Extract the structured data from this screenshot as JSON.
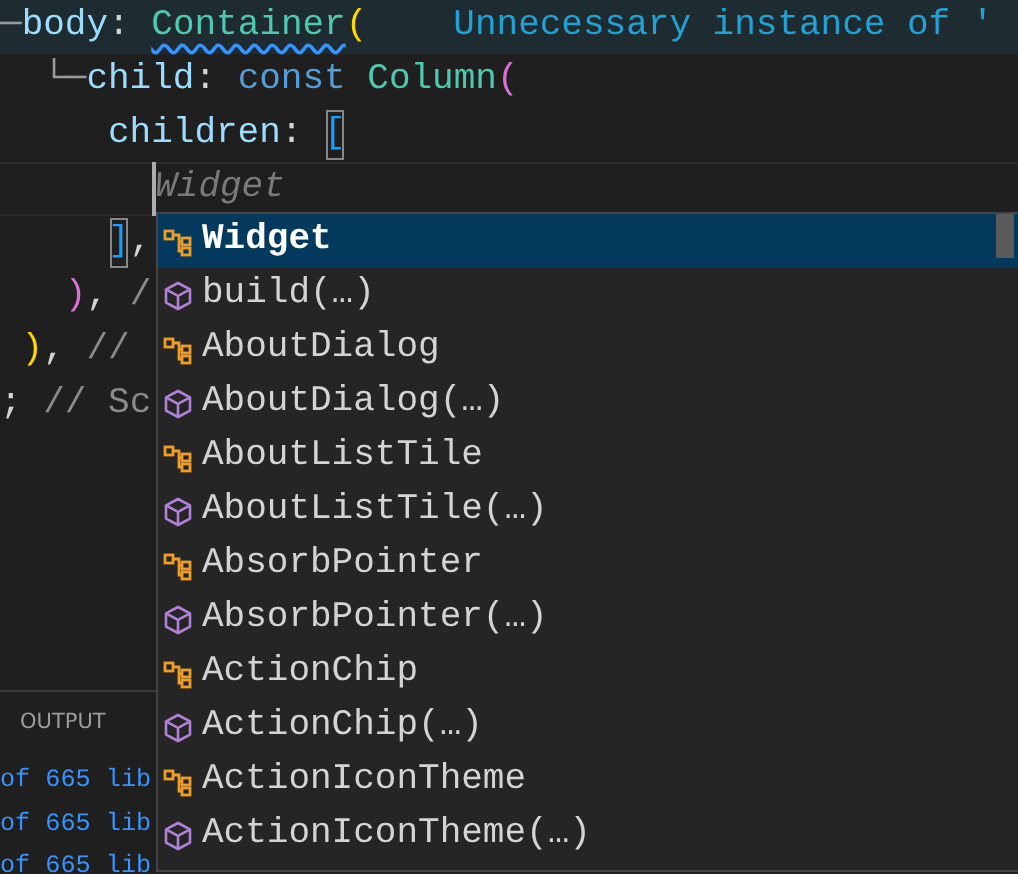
{
  "editor": {
    "lines": [
      {
        "highlighted": true,
        "segments": [
          {
            "text": "─",
            "kind": "guide"
          },
          {
            "text": "body",
            "kind": "key"
          },
          {
            "text": ": ",
            "kind": "punct"
          },
          {
            "text": "Container",
            "kind": "type",
            "squiggle": true
          },
          {
            "text": "(",
            "kind": "bracket1"
          }
        ],
        "diagnostic": "Unnecessary instance of '"
      },
      {
        "highlighted": false,
        "segments": [
          {
            "text": " └─",
            "kind": "guide"
          },
          {
            "text": "child",
            "kind": "key"
          },
          {
            "text": ": ",
            "kind": "punct"
          },
          {
            "text": "const ",
            "kind": "keyword"
          },
          {
            "text": "Column",
            "kind": "type"
          },
          {
            "text": "(",
            "kind": "bracket2"
          }
        ]
      },
      {
        "highlighted": false,
        "segments": [
          {
            "text": "children",
            "kind": "key"
          },
          {
            "text": ": ",
            "kind": "punct"
          },
          {
            "text": "[",
            "kind": "bracket3-match"
          }
        ]
      },
      {
        "highlighted": false,
        "cursor": true,
        "segments": [
          {
            "text": "Widget",
            "kind": "ghost"
          }
        ]
      },
      {
        "highlighted": false,
        "segments": [
          {
            "text": "]",
            "kind": "bracket3-match"
          },
          {
            "text": ",",
            "kind": "punct"
          }
        ]
      },
      {
        "highlighted": false,
        "segments": [
          {
            "text": ")",
            "kind": "bracket2"
          },
          {
            "text": ", ",
            "kind": "punct"
          },
          {
            "text": "/",
            "kind": "comment"
          }
        ]
      },
      {
        "highlighted": false,
        "segments": [
          {
            "text": ")",
            "kind": "bracket1"
          },
          {
            "text": ", ",
            "kind": "punct"
          },
          {
            "text": "//",
            "kind": "comment"
          }
        ]
      },
      {
        "highlighted": false,
        "segments": [
          {
            "text": "; ",
            "kind": "punct"
          },
          {
            "text": "// Sc",
            "kind": "comment"
          }
        ]
      }
    ]
  },
  "suggestions": [
    {
      "label": "Widget",
      "kind": "class",
      "selected": true
    },
    {
      "label": "build(…)",
      "kind": "constructor",
      "selected": false
    },
    {
      "label": "AboutDialog",
      "kind": "class",
      "selected": false
    },
    {
      "label": "AboutDialog(…)",
      "kind": "constructor",
      "selected": false
    },
    {
      "label": "AboutListTile",
      "kind": "class",
      "selected": false
    },
    {
      "label": "AboutListTile(…)",
      "kind": "constructor",
      "selected": false
    },
    {
      "label": "AbsorbPointer",
      "kind": "class",
      "selected": false
    },
    {
      "label": "AbsorbPointer(…)",
      "kind": "constructor",
      "selected": false
    },
    {
      "label": "ActionChip",
      "kind": "class",
      "selected": false
    },
    {
      "label": "ActionChip(…)",
      "kind": "constructor",
      "selected": false
    },
    {
      "label": "ActionIconTheme",
      "kind": "class",
      "selected": false
    },
    {
      "label": "ActionIconTheme(…)",
      "kind": "constructor",
      "selected": false
    }
  ],
  "panel": {
    "tab": "OUTPUT",
    "lines": [
      "of 665 lib",
      "of 665 lib",
      "of 665 lib"
    ]
  }
}
